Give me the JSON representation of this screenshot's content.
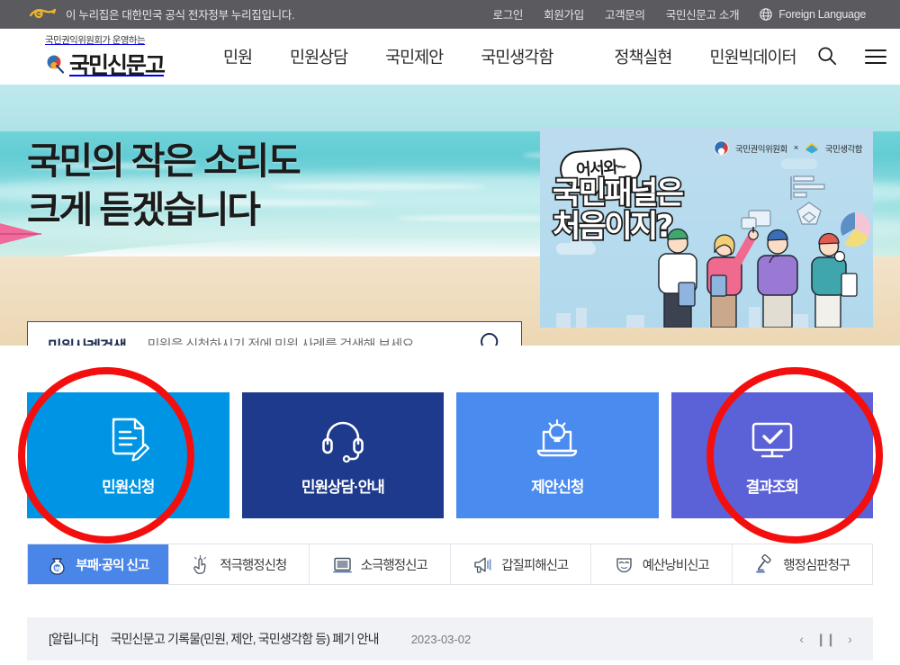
{
  "topbar": {
    "egov_mark": "egov-logo-icon",
    "egov_text": "이 누리집은 대한민국 공식 전자정부 누리집입니다.",
    "links": [
      {
        "label": "로그인",
        "name": "login"
      },
      {
        "label": "회원가입",
        "name": "signup"
      },
      {
        "label": "고객문의",
        "name": "customer-inquiry"
      },
      {
        "label": "국민신문고 소개",
        "name": "about"
      }
    ],
    "language": {
      "label": "Foreign Language",
      "icon": "globe-icon"
    }
  },
  "header": {
    "logo_sup": "국민권익위원회가 운영하는",
    "logo_word": "국민신문고",
    "logo_emblem": "taeguk-flower-icon",
    "nav": [
      {
        "label": "민원",
        "name": "minwon"
      },
      {
        "label": "민원상담",
        "name": "minwon-consult"
      },
      {
        "label": "국민제안",
        "name": "citizen-proposal"
      },
      {
        "label": "국민생각함",
        "name": "citizen-thinkbox"
      },
      {
        "label": "정책실현",
        "name": "policy-realization"
      },
      {
        "label": "민원빅데이터",
        "name": "minwon-bigdata"
      }
    ],
    "search_icon": "search-icon",
    "menu_icon": "hamburger-menu-icon"
  },
  "hero": {
    "headline_line1": "국민의 작은 소리도",
    "headline_line2": "크게 듣겠습니다",
    "search": {
      "label": "민원사례검색",
      "placeholder": "민원을 신청하시기 전에 민원 사례를 검색해 보세요.",
      "value": "",
      "button_icon": "search-icon"
    }
  },
  "panel_banner": {
    "bubble": "어서와~",
    "headline_line1": "국민패널은",
    "headline_line2": "처음이지?",
    "org_primary": "국민권익위원회",
    "org_separator": "×",
    "org_secondary": "국민생각함"
  },
  "cards": [
    {
      "label": "민원신청",
      "icon": "document-pen-icon",
      "color": "#0095e4",
      "annotated": true
    },
    {
      "label": "민원상담·안내",
      "icon": "headset-icon",
      "color": "#1e3a8c",
      "annotated": false
    },
    {
      "label": "제안신청",
      "icon": "laptop-bulb-icon",
      "color": "#4a8bf0",
      "annotated": false
    },
    {
      "label": "결과조회",
      "icon": "monitor-check-icon",
      "color": "#5b62d8",
      "annotated": true
    }
  ],
  "quick_tabs": [
    {
      "label": "부패·공익 신고",
      "icon": "money-bag-icon",
      "active": true
    },
    {
      "label": "적극행정신청",
      "icon": "hand-click-icon",
      "active": false
    },
    {
      "label": "소극행정신고",
      "icon": "monitor-icon",
      "active": false
    },
    {
      "label": "갑질피해신고",
      "icon": "megaphone-icon",
      "active": false
    },
    {
      "label": "예산낭비신고",
      "icon": "mask-icon",
      "active": false
    },
    {
      "label": "행정심판청구",
      "icon": "gavel-icon",
      "active": false
    }
  ],
  "notice": {
    "tag": "[알립니다]",
    "title": "국민신문고 기록물(민원, 제안, 국민생각함 등) 폐기 안내",
    "date": "2023-03-02",
    "prev": "‹",
    "pause": "❙❙",
    "next": "›"
  },
  "colors": {
    "topbar_bg": "#5a5a5f",
    "accent_blue": "#4a86e8",
    "annotation_red": "#f40f0f",
    "notice_bg": "#f0f2f5"
  }
}
